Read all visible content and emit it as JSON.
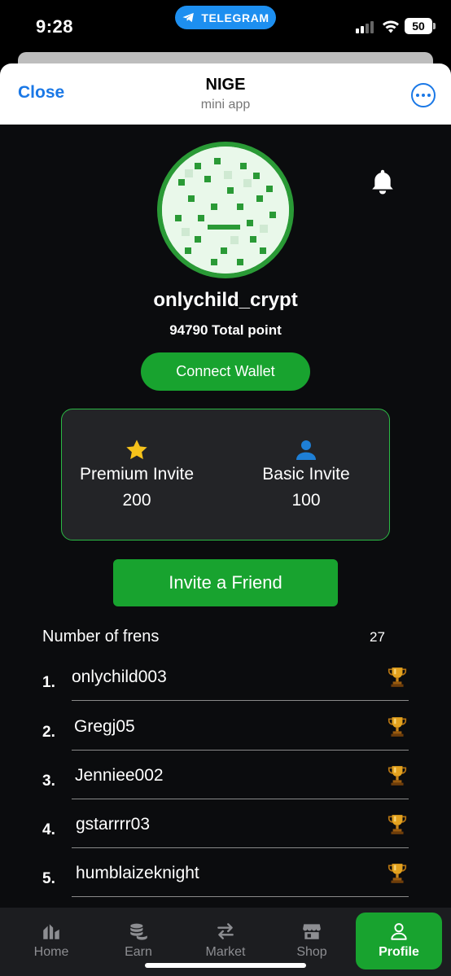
{
  "status_bar": {
    "time": "9:28",
    "app_pill": "TELEGRAM",
    "battery": "50"
  },
  "header": {
    "close_label": "Close",
    "title": "NIGE",
    "subtitle": "mini app"
  },
  "profile": {
    "username": "onlychild_crypt",
    "total_points": "94790 Total point",
    "connect_wallet_label": "Connect Wallet"
  },
  "invites": {
    "premium": {
      "label": "Premium Invite",
      "count": "200",
      "icon": "star-icon"
    },
    "basic": {
      "label": "Basic Invite",
      "count": "100",
      "icon": "person-icon"
    }
  },
  "invite_friend_label": "Invite a Friend",
  "frens": {
    "label": "Number of frens",
    "count": "27",
    "list": [
      {
        "rank": "1.",
        "name": "onlychild003"
      },
      {
        "rank": "2.",
        "name": "Gregj05"
      },
      {
        "rank": "3.",
        "name": "Jenniee002"
      },
      {
        "rank": "4.",
        "name": "gstarrrr03"
      },
      {
        "rank": "5.",
        "name": "humblaizeknight"
      }
    ]
  },
  "nav": {
    "items": [
      {
        "label": "Home",
        "icon": "home-icon"
      },
      {
        "label": "Earn",
        "icon": "coins-icon"
      },
      {
        "label": "Market",
        "icon": "swap-icon"
      },
      {
        "label": "Shop",
        "icon": "shop-icon"
      },
      {
        "label": "Profile",
        "icon": "profile-icon",
        "active": true
      }
    ]
  },
  "colors": {
    "accent_green": "#18a32f",
    "link_blue": "#1a78e6",
    "background": "#0b0c0e",
    "star": "#f5c21b",
    "person": "#1e7fd6"
  }
}
